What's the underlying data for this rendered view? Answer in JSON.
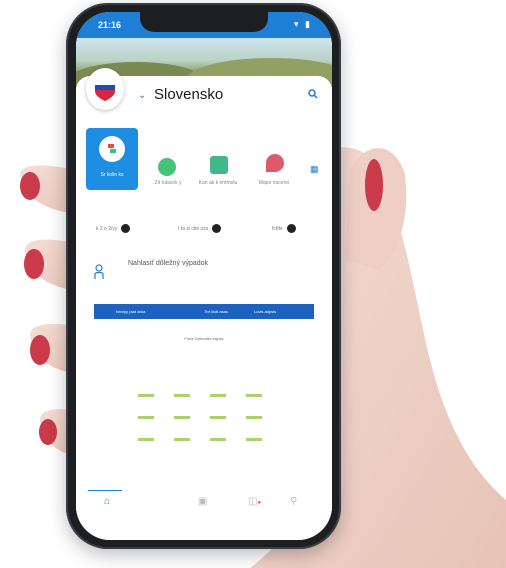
{
  "status": {
    "time": "21:16",
    "icons": "▾ ▮"
  },
  "header": {
    "country": "Slovensko"
  },
  "shortcuts": [
    {
      "label": "Sr kolin ks",
      "active": true
    },
    {
      "label": "Zit rulacek y",
      "active": false
    },
    {
      "label": "Kan ak k entmolu",
      "active": false
    },
    {
      "label": "Mape iracerei",
      "active": false
    }
  ],
  "tabs": [
    "k 2 o 2/yy",
    "t ta zi ctie ozs",
    "fcfde"
  ],
  "report": {
    "text": "Nahlasiť dôležný výpadok"
  },
  "thumb": {
    "bar": [
      "Nnviyy (aat olsia",
      "Tivt iliotl asas",
      "Luvis adpsts"
    ],
    "title": "Fone Ohmodto exjoxs"
  },
  "colors": {
    "primary": "#1e7fd6",
    "phone": "#1c1e22",
    "skin": "#f2d7cf"
  }
}
